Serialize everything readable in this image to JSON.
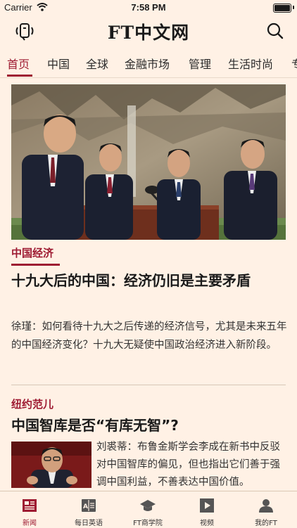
{
  "status_bar": {
    "carrier": "Carrier",
    "time": "7:58 PM"
  },
  "header": {
    "logo": "FT中文网",
    "audio_icon": "audio-icon",
    "search_icon": "search-icon"
  },
  "nav": {
    "tabs": [
      "首页",
      "中国",
      "全球",
      "金融市场",
      "管理",
      "生活时尚",
      "专"
    ],
    "active": "首页"
  },
  "lead_article": {
    "tag": "中国经济",
    "headline": "十九大后的中国：经济仍旧是主要矛盾",
    "summary": "徐瑾：如何看待十九大之后传递的经济信号，尤其是未来五年的中国经济变化？十九大无疑使中国政治经济进入新阶段。"
  },
  "second_article": {
    "tag": "纽约范儿",
    "headline": "中国智库是否“有库无智”?",
    "summary": "刘裘蒂：布鲁金斯学会李成在新书中反驳对中国智库的偏见，但也指出它们善于强调中国利益，不善表达中国价值。"
  },
  "tab_bar": {
    "items": [
      {
        "label": "新闻",
        "icon": "news-icon"
      },
      {
        "label": "每日英语",
        "icon": "english-icon"
      },
      {
        "label": "FT商学院",
        "icon": "academy-icon"
      },
      {
        "label": "视频",
        "icon": "video-icon"
      },
      {
        "label": "我的FT",
        "icon": "profile-icon"
      }
    ],
    "active": "新闻"
  },
  "colors": {
    "background": "#fff1e5",
    "accent": "#9e1b32",
    "text": "#1a1a1a"
  }
}
